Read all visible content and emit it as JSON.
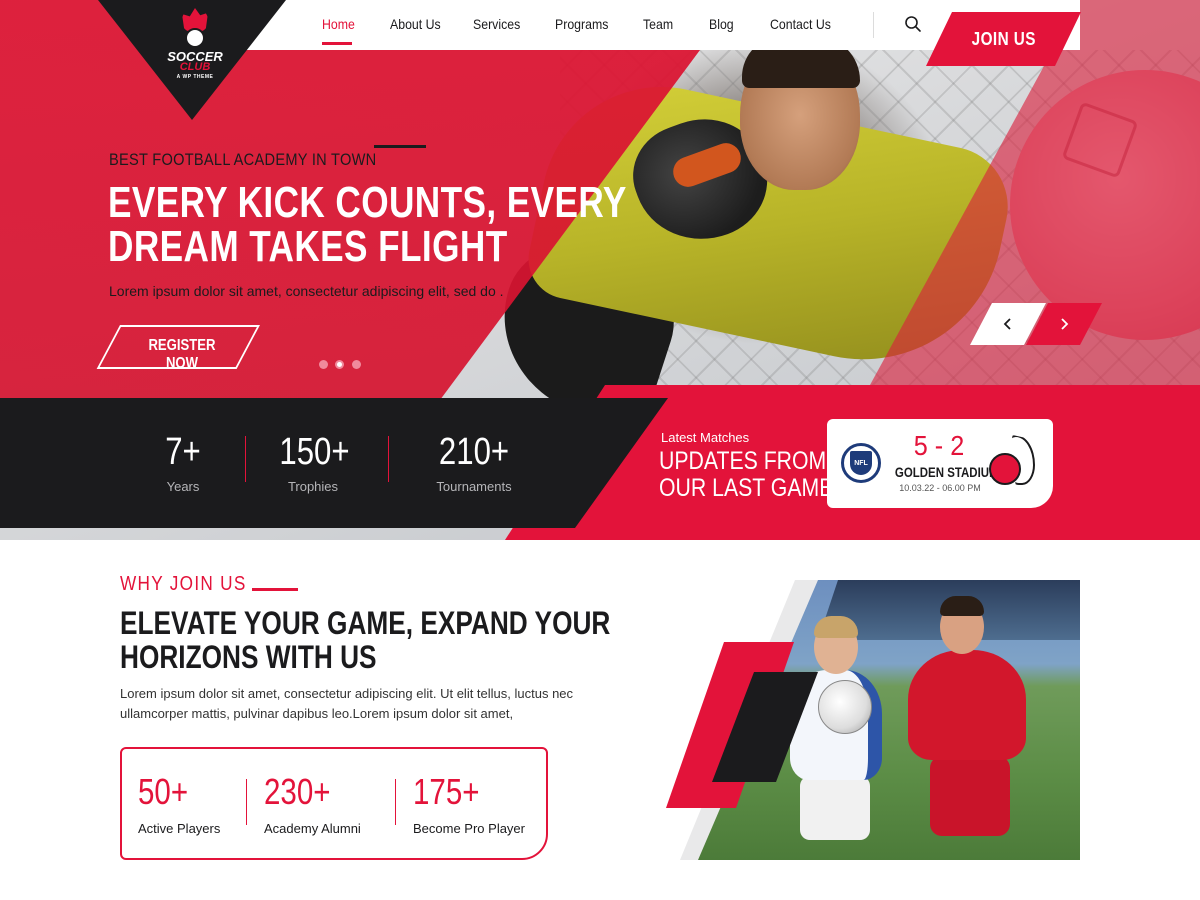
{
  "brand": {
    "logo_line1": "SOCCER",
    "logo_line2": "CLUB",
    "logo_line3": "A WP THEME"
  },
  "colors": {
    "accent": "#e3133a",
    "dark": "#1b1b1d",
    "white": "#ffffff"
  },
  "nav": {
    "items": [
      {
        "label": "Home",
        "active": true
      },
      {
        "label": "About Us",
        "active": false
      },
      {
        "label": "Services",
        "active": false
      },
      {
        "label": "Programs",
        "active": false
      },
      {
        "label": "Team",
        "active": false
      },
      {
        "label": "Blog",
        "active": false
      },
      {
        "label": "Contact Us",
        "active": false
      }
    ],
    "search_icon": "search-icon",
    "join_label": "JOIN US"
  },
  "hero": {
    "kicker": "BEST FOOTBALL ACADEMY IN TOWN",
    "title_line1": "EVERY KICK COUNTS, EVERY",
    "title_line2": "DREAM TAKES FLIGHT",
    "description": "Lorem ipsum dolor sit amet, consectetur adipiscing elit, sed do .",
    "register_label": "REGISTER NOW",
    "slides_count": 3,
    "active_slide": 2,
    "prev_icon": "chevron-left-icon",
    "next_icon": "chevron-right-icon"
  },
  "stats": [
    {
      "value": "7+",
      "label": "Years"
    },
    {
      "value": "150+",
      "label": "Trophies"
    },
    {
      "value": "210+",
      "label": "Tournaments"
    }
  ],
  "latest": {
    "kicker": "Latest Matches",
    "title_line1": "UPDATES FROM",
    "title_line2": "OUR LAST GAME",
    "score": "5 - 2",
    "home_team_logo": "NFL",
    "away_team_logo": "koln-crest",
    "venue": "GOLDEN STADIUM",
    "date": "10.03.22 - 06.00 PM"
  },
  "why": {
    "kicker": "WHY JOIN US",
    "title_line1": "ELEVATE YOUR GAME, EXPAND YOUR",
    "title_line2": "HORIZONS WITH US",
    "description": "Lorem ipsum dolor sit amet, consectetur adipiscing elit. Ut elit tellus, luctus nec ullamcorper mattis, pulvinar dapibus leo.Lorem ipsum dolor sit amet,",
    "stats": [
      {
        "value": "50+",
        "label": "Active Players"
      },
      {
        "value": "230+",
        "label": "Academy Alumni"
      },
      {
        "value": "175+",
        "label": "Become Pro Player"
      }
    ]
  }
}
